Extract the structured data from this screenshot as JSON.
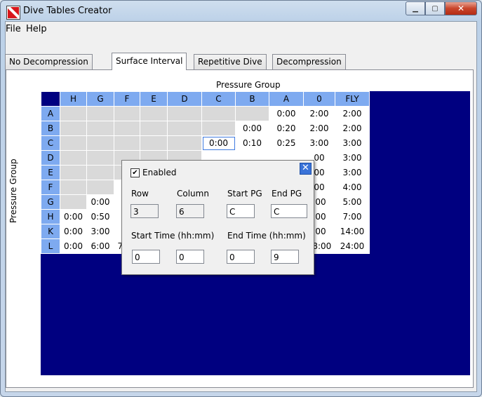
{
  "window": {
    "title": "Dive Tables Creator"
  },
  "menu": [
    "File",
    "Help"
  ],
  "tabs": [
    "No Decompression",
    "Surface Interval",
    "Repetitive Dive",
    "Decompression"
  ],
  "active_tab": "Surface Interval",
  "axis": {
    "top": "Pressure Group",
    "left": "Pressure Group"
  },
  "columns": [
    "H",
    "G",
    "F",
    "E",
    "D",
    "C",
    "B",
    "A",
    "0",
    "FLY"
  ],
  "rows": [
    {
      "label": "A",
      "cells": [
        "",
        "",
        "",
        "",
        "",
        "",
        "",
        "0:00",
        "2:00",
        "2:00"
      ]
    },
    {
      "label": "B",
      "cells": [
        "",
        "",
        "",
        "",
        "",
        "",
        "0:00",
        "0:20",
        "2:00",
        "2:00"
      ]
    },
    {
      "label": "C",
      "cells": [
        "",
        "",
        "",
        "",
        "",
        "0:00",
        "0:10",
        "0:25",
        "3:00",
        "3:00"
      ]
    },
    {
      "label": "D",
      "cells": [
        "",
        "",
        "",
        "",
        "",
        "",
        "",
        "",
        "00",
        "3:00"
      ]
    },
    {
      "label": "E",
      "cells": [
        "",
        "",
        "",
        "",
        "",
        "",
        "",
        "",
        "00",
        "3:00"
      ]
    },
    {
      "label": "F",
      "cells": [
        "",
        "",
        "0",
        "",
        "",
        "",
        "",
        "",
        "00",
        "4:00"
      ]
    },
    {
      "label": "G",
      "cells": [
        "",
        "0:00",
        "0",
        "",
        "",
        "",
        "",
        "",
        ":00",
        "5:00"
      ]
    },
    {
      "label": "H",
      "cells": [
        "0:00",
        "0:50",
        "1",
        "",
        "",
        "",
        "",
        "",
        ":00",
        "7:00"
      ]
    },
    {
      "label": "K",
      "cells": [
        "0:00",
        "3:00",
        "4",
        "",
        "",
        "",
        "",
        "",
        ":00",
        "14:00"
      ]
    },
    {
      "label": "L",
      "cells": [
        "0:00",
        "6:00",
        "7:00",
        "8:30",
        "10:00",
        "12:00",
        "14:00",
        "16:30",
        "48:00",
        "24:00"
      ]
    }
  ],
  "dialog": {
    "enabled_label": "Enabled",
    "enabled_checked": true,
    "row_label": "Row",
    "column_label": "Column",
    "start_pg_label": "Start PG",
    "end_pg_label": "End PG",
    "row_value": "3",
    "column_value": "6",
    "start_pg_value": "C",
    "end_pg_value": "C",
    "start_time_label": "Start Time (hh:mm)",
    "end_time_label": "End Time (hh:mm)",
    "start_h": "0",
    "start_m": "0",
    "end_h": "0",
    "end_m": "9"
  },
  "colors": {
    "panel": "#000080",
    "header": "#7eaaf0",
    "grayed": "#d9d9d9"
  }
}
